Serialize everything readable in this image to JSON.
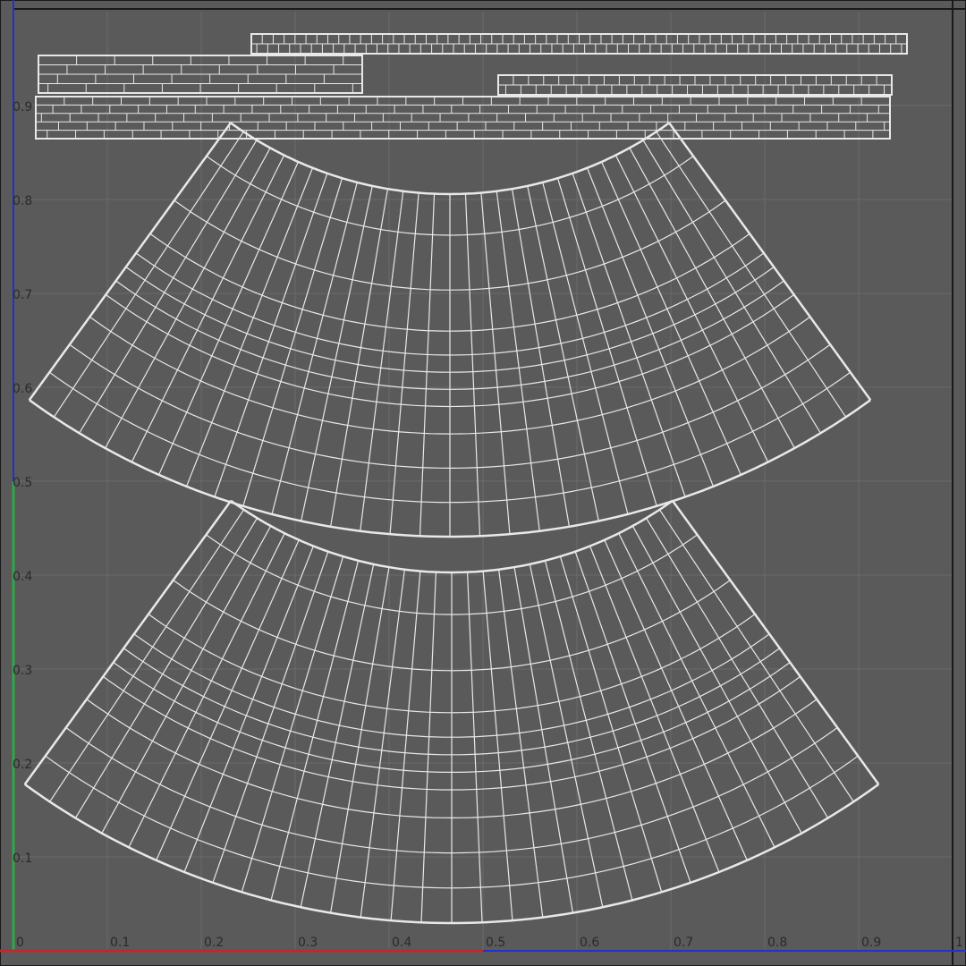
{
  "editor": {
    "background": "#5a5a5a",
    "grid_color": "#6a6a6a",
    "wire_color": "#e8e8e8",
    "frame_color": "#1a1a1a",
    "u_axis_color": "#c0282d",
    "v_axis_color": "#2fa84a",
    "border_blue": "#2430c8"
  },
  "axes": {
    "u_range": [
      0,
      1
    ],
    "v_range": [
      0,
      1
    ],
    "grid_step": 0.1,
    "x_tick_labels": [
      "0",
      "0.1",
      "0.2",
      "0.3",
      "0.4",
      "0.5",
      "0.6",
      "0.7",
      "0.8",
      "0.9",
      "1"
    ],
    "y_tick_labels": [
      "0.1",
      "0.2",
      "0.3",
      "0.4",
      "0.5",
      "0.6",
      "0.7",
      "0.8",
      "0.9"
    ]
  },
  "uv_islands": {
    "strip_count": 4,
    "fan_count": 2,
    "fan_radial_segments": 30,
    "fan_ring_count": 11
  }
}
